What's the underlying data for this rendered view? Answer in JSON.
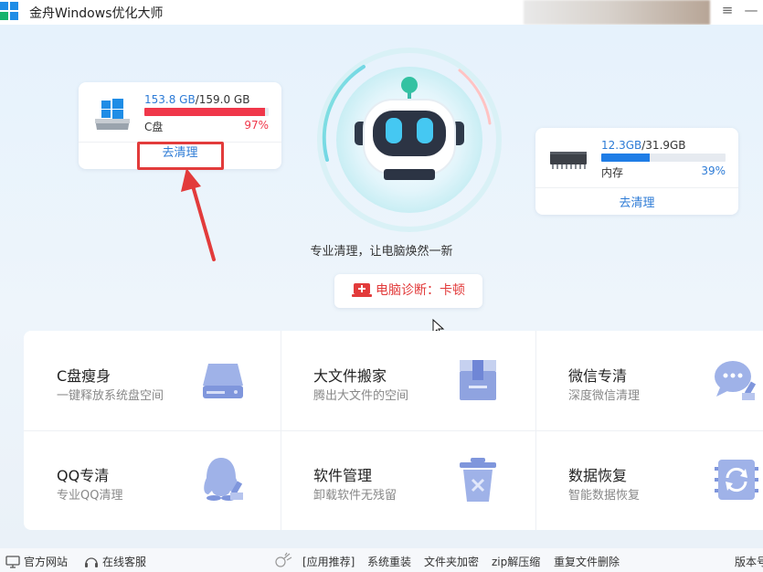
{
  "window": {
    "title": "金舟Windows优化大师",
    "menu_icon": "menu-icon",
    "minimize_icon": "minimize-icon"
  },
  "disk": {
    "used": "153.8 GB",
    "separator_total": "/159.0 GB",
    "label": "C盘",
    "percent": "97%",
    "fraction": 0.97,
    "bar_color": "#f0374a",
    "clean_label": "去清理"
  },
  "memory": {
    "used": "12.3GB",
    "separator_total": "/31.9GB",
    "label": "内存",
    "percent": "39%",
    "fraction": 0.39,
    "bar_color": "#1f7de6",
    "clean_label": "去清理"
  },
  "center": {
    "tagline": "专业清理，让电脑焕然一新",
    "diagnosis_label": "电脑诊断：卡顿"
  },
  "tools": [
    {
      "title": "C盘瘦身",
      "desc": "一键释放系统盘空间",
      "icon": "disk-drive-icon"
    },
    {
      "title": "大文件搬家",
      "desc": "腾出大文件的空间",
      "icon": "box-icon"
    },
    {
      "title": "微信专清",
      "desc": "深度微信清理",
      "icon": "chat-bubble-icon"
    },
    {
      "title": "QQ专清",
      "desc": "专业QQ清理",
      "icon": "penguin-icon"
    },
    {
      "title": "软件管理",
      "desc": "卸载软件无残留",
      "icon": "trash-icon"
    },
    {
      "title": "数据恢复",
      "desc": "智能数据恢复",
      "icon": "refresh-icon"
    }
  ],
  "footer": {
    "official_site": "官方网站",
    "online_service": "在线客服",
    "recommend": "[应用推荐]",
    "links": [
      "系统重装",
      "文件夹加密",
      "zip解压缩",
      "重复文件删除"
    ],
    "version": "版本号"
  },
  "colors": {
    "accent": "#2d7bd6",
    "alert": "#e23b3b"
  }
}
